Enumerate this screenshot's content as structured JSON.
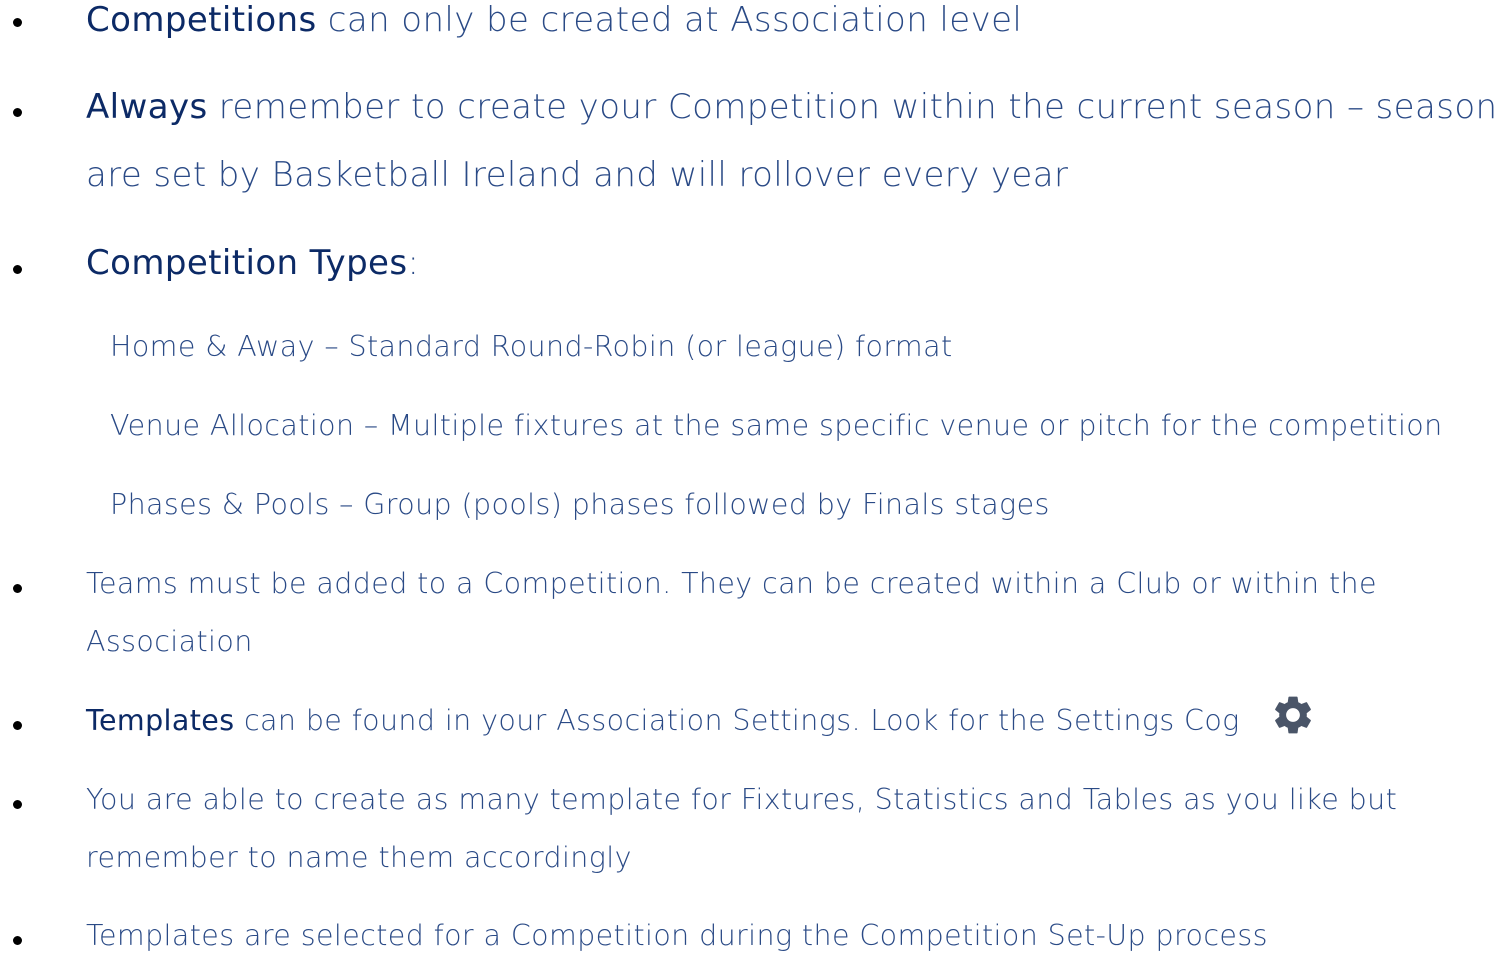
{
  "items": [
    {
      "lead": "Competitions",
      "rest": " can only be created at Association level"
    },
    {
      "lead": "Always",
      "rest": " remember to create your Competition within the current season – seasons",
      "cont": "are set by Basketball Ireland and will rollover every year"
    },
    {
      "lead": "Competition Types",
      "rest": ":"
    },
    {
      "line1": "Teams must be added to a Competition. They can be created within a Club or within the",
      "line2": "Association"
    },
    {
      "lead": "Templates",
      "rest": " can be found in your Association Settings. Look for the Settings Cog",
      "icon": "gear-icon"
    },
    {
      "line1": "You are able to create as many template for Fixtures, Statistics and Tables as you like but",
      "line2": "remember to name them accordingly"
    },
    {
      "line1": "Templates are selected for a Competition during the Competition Set-Up process"
    }
  ],
  "competition_types": [
    "Home & Away – Standard Round-Robin (or league) format",
    "Venue Allocation – Multiple fixtures at the same specific venue or pitch for the competition",
    "Phases & Pools – Group (pools) phases followed by Finals stages"
  ],
  "colors": {
    "text": "#1d3b70",
    "emphasis": "#0c2a66",
    "bullet": "#000000",
    "cog": "#4a5568"
  }
}
